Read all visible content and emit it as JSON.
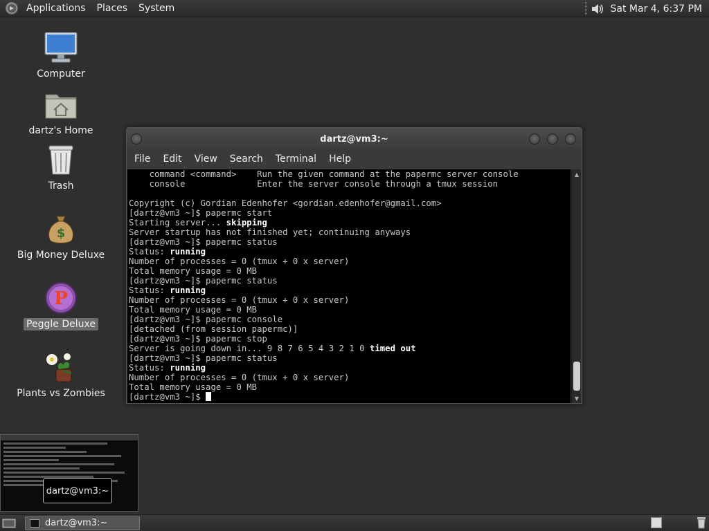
{
  "top_panel": {
    "menus": [
      "Applications",
      "Places",
      "System"
    ],
    "clock": "Sat Mar  4,  6:37 PM",
    "icons": {
      "logo": "distro-logo-icon",
      "volume": "speaker-icon"
    }
  },
  "desktop": {
    "icons": [
      {
        "label": "Computer",
        "icon": "monitor-icon"
      },
      {
        "label": "dartz's Home",
        "icon": "home-folder-icon"
      },
      {
        "label": "Trash",
        "icon": "trash-icon"
      },
      {
        "label": "Big Money Deluxe",
        "icon": "money-bag-icon"
      },
      {
        "label": "Peggle Deluxe",
        "icon": "peggle-icon",
        "selected": true
      },
      {
        "label": "Plants vs Zombies",
        "icon": "plants-vs-zombies-icon"
      }
    ]
  },
  "terminal": {
    "title": "dartz@vm3:~",
    "menus": [
      "File",
      "Edit",
      "View",
      "Search",
      "Terminal",
      "Help"
    ],
    "lines": [
      [
        {
          "t": "    command <command>    Run the given command at the papermc server console"
        }
      ],
      [
        {
          "t": "    console              Enter the server console through a tmux session"
        }
      ],
      [
        {
          "t": ""
        }
      ],
      [
        {
          "t": "Copyright (c) Gordian Edenhofer <gordian.edenhofer@gmail.com>"
        }
      ],
      [
        {
          "t": "[dartz@vm3 ~]$ papermc start"
        }
      ],
      [
        {
          "t": "Starting server... "
        },
        {
          "t": "skipping",
          "b": true
        }
      ],
      [
        {
          "t": "Server startup has not finished yet; continuing anyways"
        }
      ],
      [
        {
          "t": "[dartz@vm3 ~]$ papermc status"
        }
      ],
      [
        {
          "t": "Status: "
        },
        {
          "t": "running",
          "b": true
        }
      ],
      [
        {
          "t": "Number of processes = 0 (tmux + 0 x server)"
        }
      ],
      [
        {
          "t": "Total memory usage = 0 MB"
        }
      ],
      [
        {
          "t": "[dartz@vm3 ~]$ papermc status"
        }
      ],
      [
        {
          "t": "Status: "
        },
        {
          "t": "running",
          "b": true
        }
      ],
      [
        {
          "t": "Number of processes = 0 (tmux + 0 x server)"
        }
      ],
      [
        {
          "t": "Total memory usage = 0 MB"
        }
      ],
      [
        {
          "t": "[dartz@vm3 ~]$ papermc console"
        }
      ],
      [
        {
          "t": "[detached (from session papermc)]"
        }
      ],
      [
        {
          "t": "[dartz@vm3 ~]$ papermc stop"
        }
      ],
      [
        {
          "t": "Server is going down in... 9 8 7 6 5 4 3 2 1 0 "
        },
        {
          "t": "timed out",
          "b": true
        }
      ],
      [
        {
          "t": "[dartz@vm3 ~]$ papermc status"
        }
      ],
      [
        {
          "t": "Status: "
        },
        {
          "t": "running",
          "b": true
        }
      ],
      [
        {
          "t": "Number of processes = 0 (tmux + 0 x server)"
        }
      ],
      [
        {
          "t": "Total memory usage = 0 MB"
        }
      ],
      [
        {
          "t": "[dartz@vm3 ~]$ "
        }
      ]
    ],
    "scroll_position": 0.9
  },
  "preview": {
    "tooltip": "dartz@vm3:~"
  },
  "bottom_panel": {
    "task_label": "dartz@vm3:~",
    "icons": {
      "show_desktop": "show-desktop-icon",
      "task": "terminal-icon",
      "trash": "trash-applet-icon"
    }
  },
  "colors": {
    "terminal_bg": "#000000",
    "terminal_fg": "#c8c8c8",
    "desktop_bg": "#2f2f2f"
  }
}
